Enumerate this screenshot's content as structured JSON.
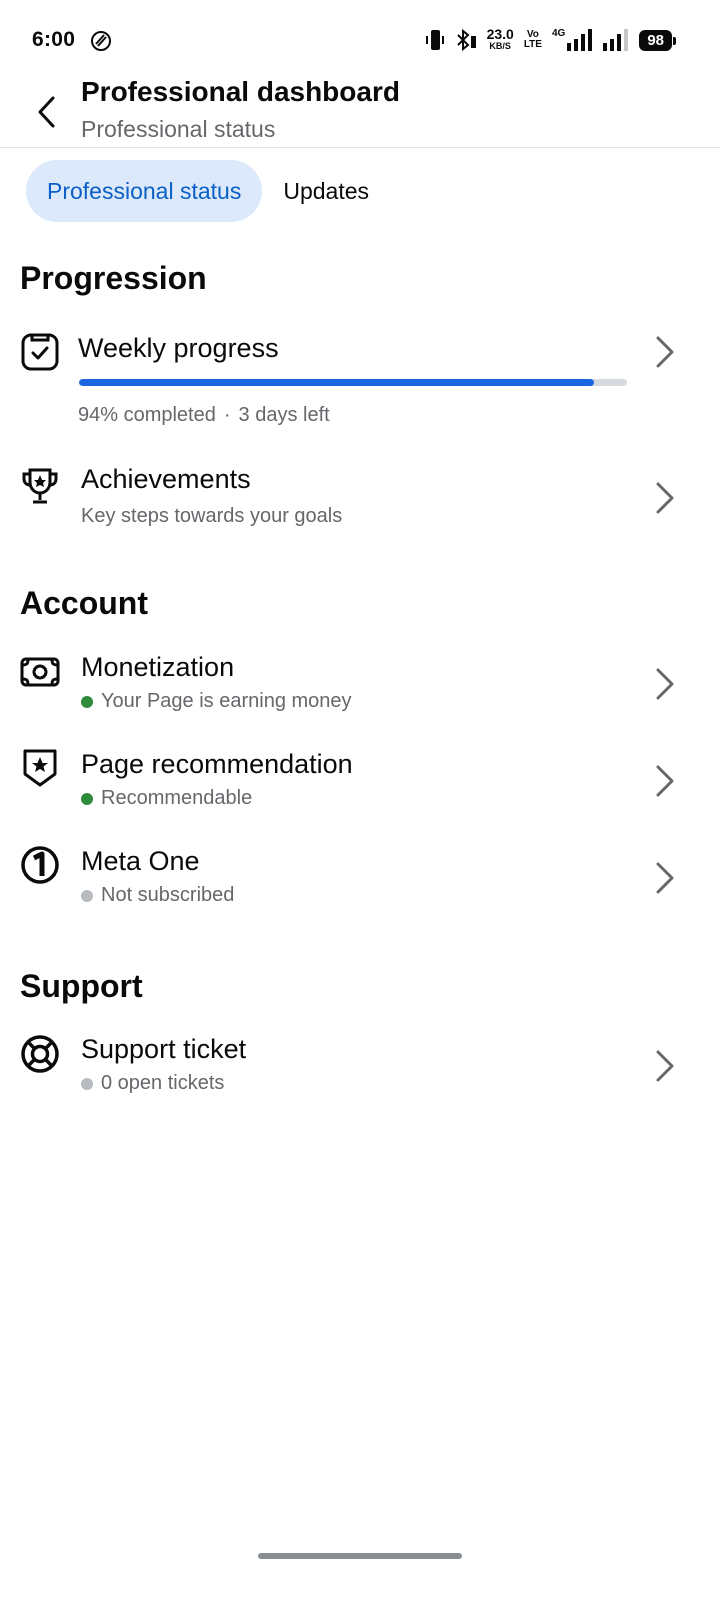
{
  "status_bar": {
    "time": "6:00",
    "speed_value": "23.0",
    "speed_unit": "KB/S",
    "volte_top": "Vo",
    "volte_bottom": "LTE",
    "network": "4G",
    "battery": "98"
  },
  "header": {
    "title": "Professional dashboard",
    "subtitle": "Professional status"
  },
  "tabs": [
    {
      "label": "Professional status",
      "active": true
    },
    {
      "label": "Updates",
      "active": false
    }
  ],
  "progression": {
    "section_title": "Progression",
    "weekly": {
      "title": "Weekly progress",
      "progress_fraction": 0.94,
      "percent_text": "94% completed",
      "separator": "·",
      "days_left": "3 days left"
    },
    "achievements": {
      "title": "Achievements",
      "subtitle": "Key steps towards your goals"
    }
  },
  "account": {
    "section_title": "Account",
    "items": [
      {
        "title": "Monetization",
        "status": "Your Page is earning money",
        "status_color": "#2e8b3a",
        "icon": "money-icon"
      },
      {
        "title": "Page recommendation",
        "status": "Recommendable",
        "status_color": "#2e8b3a",
        "icon": "shield-star-icon"
      },
      {
        "title": "Meta One",
        "status": "Not subscribed",
        "status_color": "#b8bbbf",
        "icon": "meta-one-icon"
      }
    ]
  },
  "support": {
    "section_title": "Support",
    "items": [
      {
        "title": "Support ticket",
        "status": "0 open tickets",
        "status_color": "#b8bbbf",
        "icon": "lifebuoy-icon"
      }
    ]
  },
  "colors": {
    "accent": "#1b66e0",
    "tab_active_bg": "#dbe9fb",
    "tab_active_text": "#0b5fc6",
    "secondary_text": "#65676b"
  }
}
